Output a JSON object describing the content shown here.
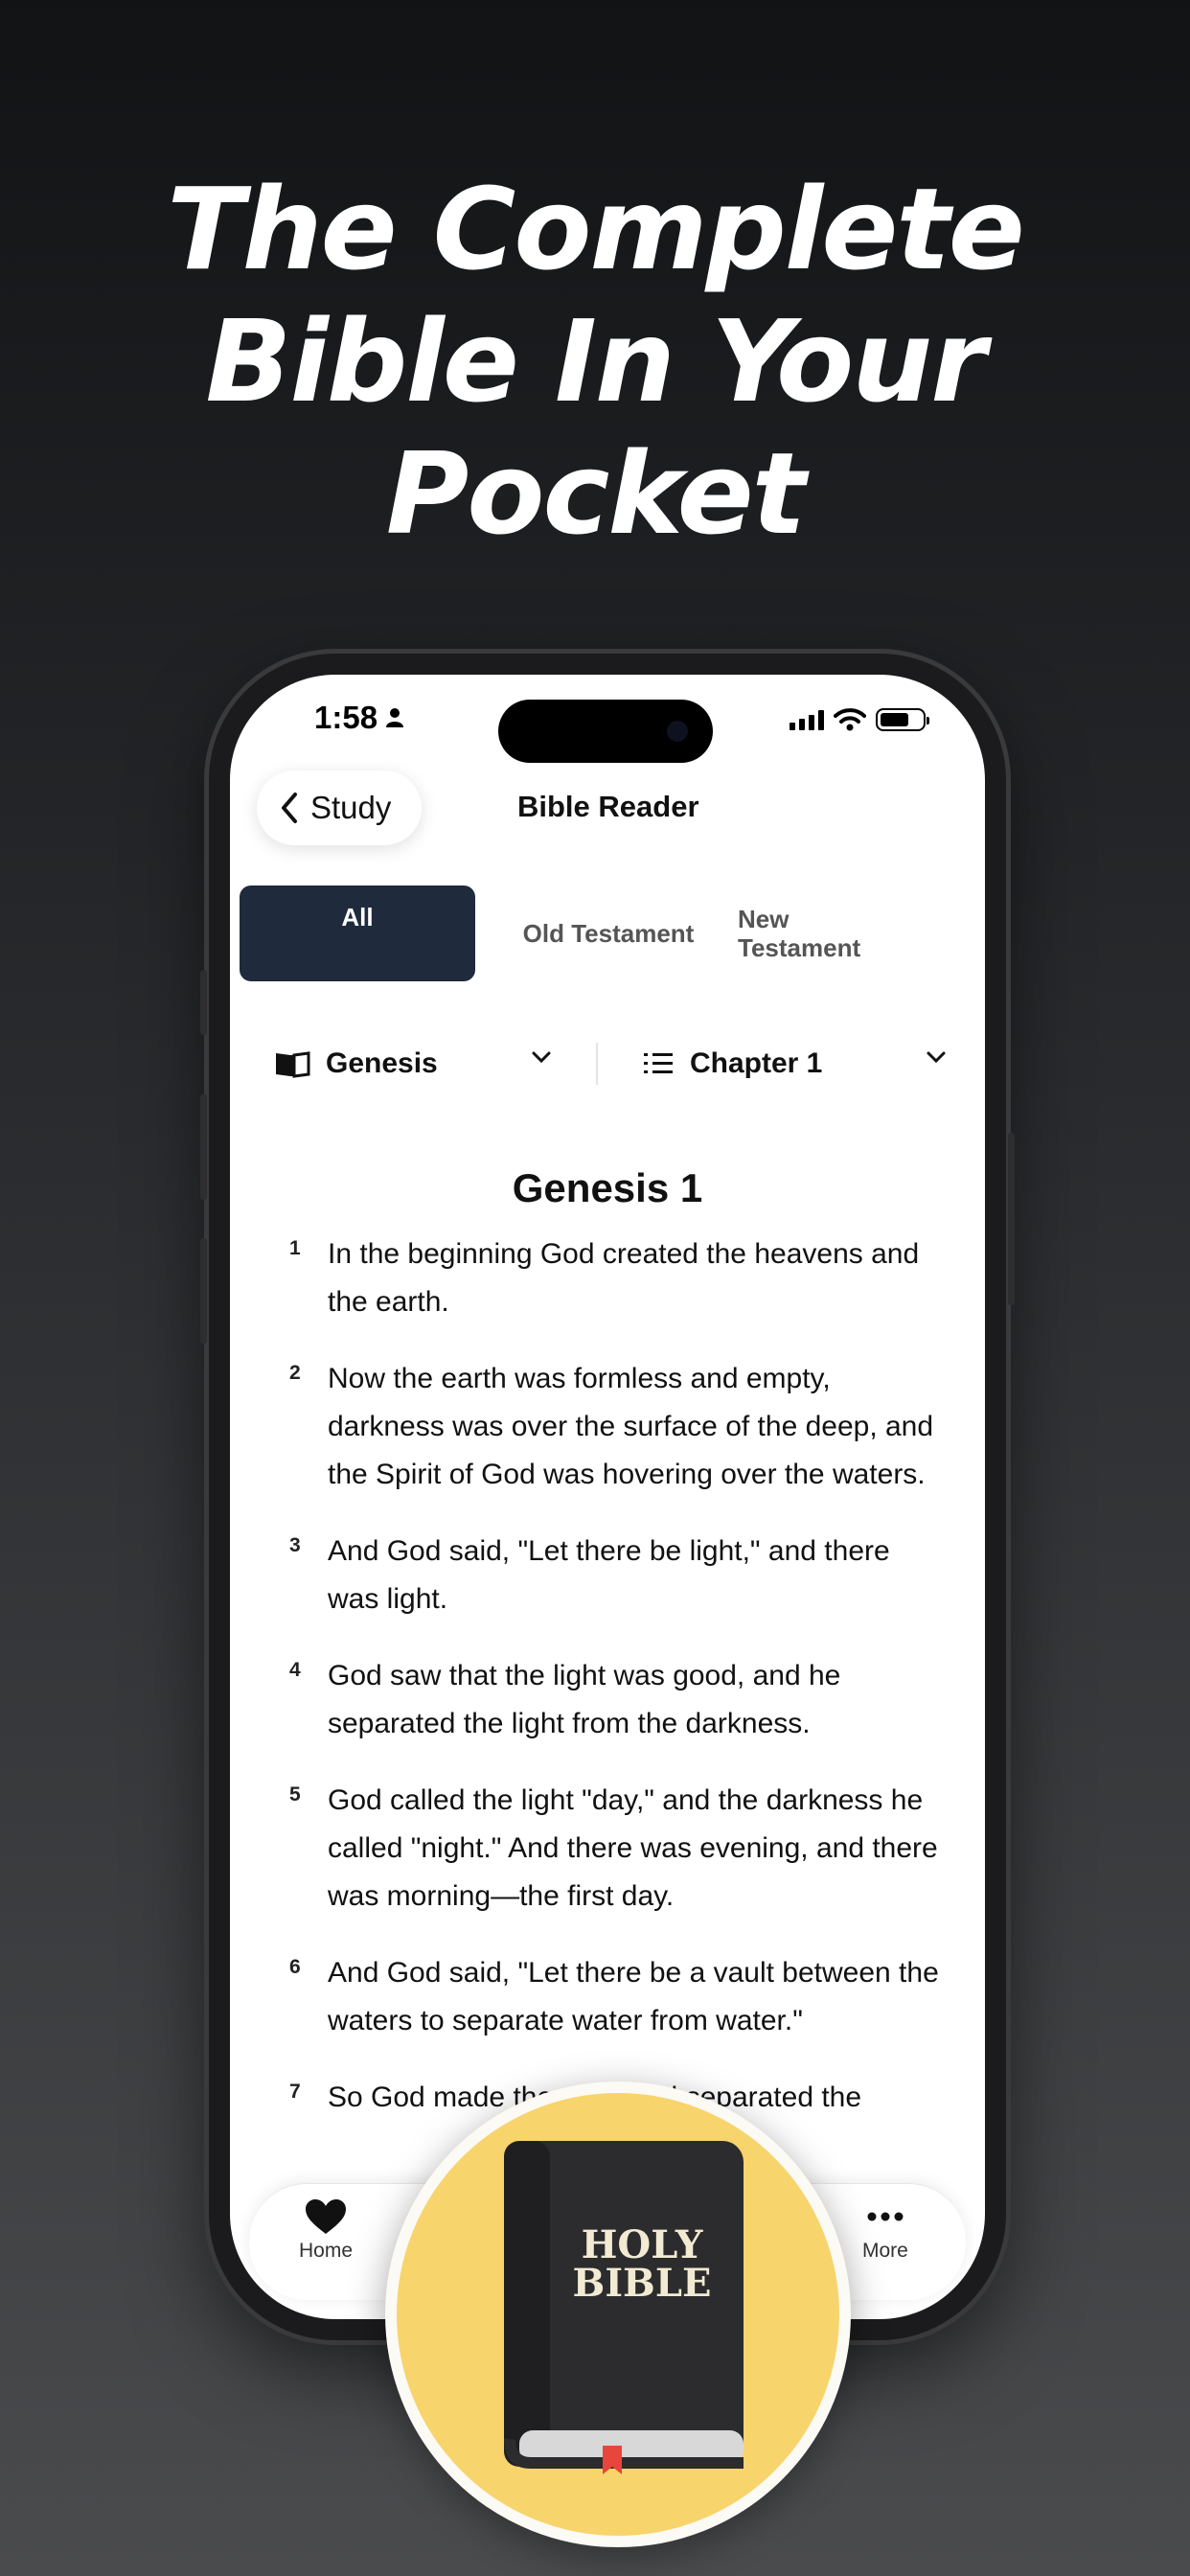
{
  "headline": {
    "line1": "The Complete",
    "line2": "Bible In Your",
    "line3": "Pocket"
  },
  "status_bar": {
    "time": "1:58"
  },
  "nav": {
    "back_label": "Study",
    "title": "Bible Reader"
  },
  "tabs": [
    {
      "label": "All",
      "active": true
    },
    {
      "label": "Old Testament",
      "active": false
    },
    {
      "label": "New Testament",
      "active": false
    }
  ],
  "selectors": {
    "book": "Genesis",
    "chapter": "Chapter 1"
  },
  "chapter_title": "Genesis 1",
  "verses": [
    {
      "num": "1",
      "text": "In the beginning God created the heavens and the earth."
    },
    {
      "num": "2",
      "text": "Now the earth was formless and empty, darkness was over the surface of the deep, and the Spirit of God was hovering over the waters."
    },
    {
      "num": "3",
      "text": "And God said, \"Let there be light,\" and there was light."
    },
    {
      "num": "4",
      "text": "God saw that the light was good, and he separated the light from the darkness."
    },
    {
      "num": "5",
      "text": "God called the light \"day,\" and the darkness he called \"night.\" And there was evening, and there was morning—the first day."
    },
    {
      "num": "6",
      "text": "And God said, \"Let there be a vault between the waters to separate water from water.\""
    },
    {
      "num": "7",
      "text": "So God made the vault and separated the"
    }
  ],
  "tabbar": {
    "home": "Home",
    "more": "More"
  },
  "badge": {
    "book_title_line1": "HOLY",
    "book_title_line2": "BIBLE"
  },
  "colors": {
    "active_tab": "#1f2a3c",
    "badge_bg": "#f8d46c",
    "book_cover": "#3a3a3c"
  }
}
